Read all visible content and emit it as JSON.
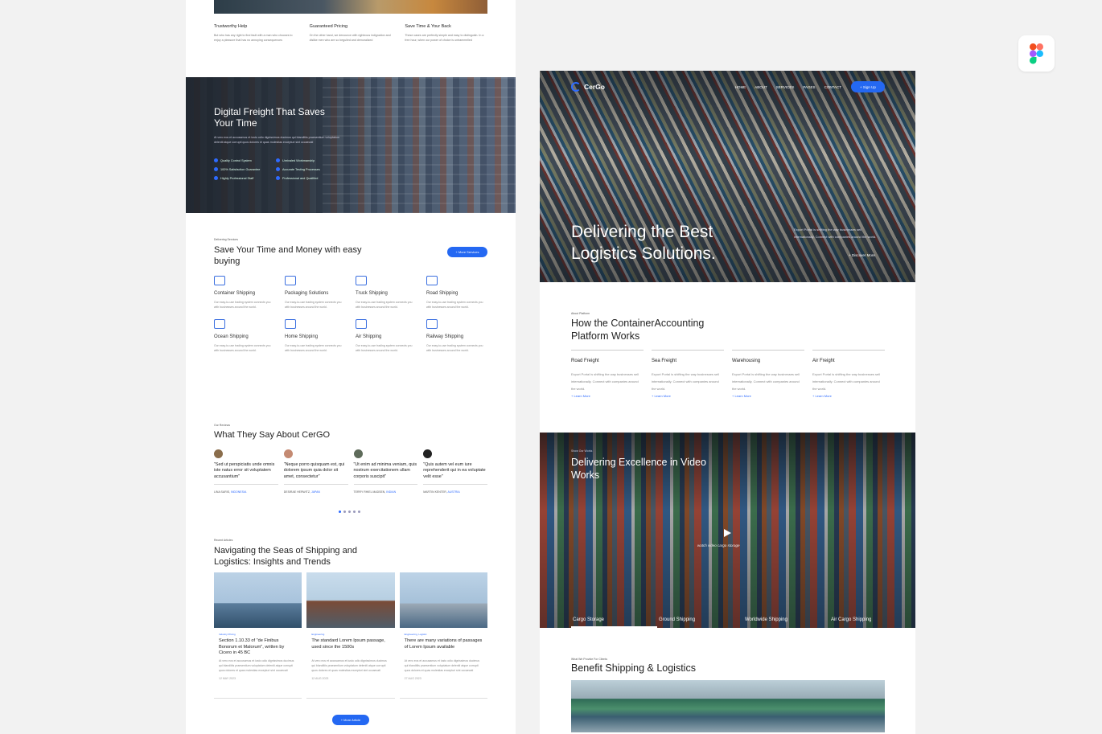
{
  "left": {
    "features": [
      {
        "title": "Trustworthy Help",
        "desc": "But who has any right to find fault with a man who chooses to enjoy a pleasure that has no annoying consequences"
      },
      {
        "title": "Guaranteed Pricing",
        "desc": "On the other hand, we denounce with righteous indignation and dislike men who are so beguiled and demoralized"
      },
      {
        "title": "Save Time & Your Back",
        "desc": "These cases are perfectly simple and easy to distinguish. In a free hour, when our power of choice is untrammelled"
      }
    ],
    "freight": {
      "title": "Digital Freight That Saves Your Time",
      "desc": "At vero eos et accusamus et iusto odio dignissimos ducimus qui blanditiis praesentium voluptatum deleniti atque corrupti quos dolores et quas molestias excepturi sint occaecati",
      "bullets": [
        "Quality Control System",
        "Unrivaled Workmanship",
        "100% Satisfaction Guarantee",
        "Accurate Testing Processes",
        "Highly Professional Staff",
        "Professional and Qualified"
      ]
    },
    "services": {
      "kicker": "Delivering Services",
      "title": "Save Your Time and Money with easy buying",
      "button": "+ More Services",
      "items": [
        {
          "icon": "container-icon",
          "title": "Container Shipping",
          "desc": "Our easy-to-use trading system connects you with businesses around the world."
        },
        {
          "icon": "box-icon",
          "title": "Packaging Solutions",
          "desc": "Our easy-to-use trading system connects you with businesses around the world."
        },
        {
          "icon": "truck-icon",
          "title": "Truck Shipping",
          "desc": "Our easy-to-use trading system connects you with businesses around the world."
        },
        {
          "icon": "road-icon",
          "title": "Road Shipping",
          "desc": "Our easy-to-use trading system connects you with businesses around the world."
        },
        {
          "icon": "ship-icon",
          "title": "Ocean Shipping",
          "desc": "Our easy-to-use trading system connects you with businesses around the world."
        },
        {
          "icon": "home-icon",
          "title": "Home Shipping",
          "desc": "Our easy-to-use trading system connects you with businesses around the world."
        },
        {
          "icon": "plane-icon",
          "title": "Air Shipping",
          "desc": "Our easy-to-use trading system connects you with businesses around the world."
        },
        {
          "icon": "train-icon",
          "title": "Railway Shipping",
          "desc": "Our easy-to-use trading system connects you with businesses around the world."
        }
      ]
    },
    "testimonials": {
      "kicker": "Our Reviews",
      "title": "What They Say About CerGO",
      "items": [
        {
          "quote": "\"Sed ut perspiciatis unde omnis iste natus error sit voluptatem accusantium\"",
          "name": "LINA SARIS,",
          "country": "INDONESIA",
          "color": "#8a6d4b"
        },
        {
          "quote": "\"Neque porro quisquam est, qui dolorem ipsum quia dolor sit amet, consectetur\"",
          "name": "DESIRAE HERWITZ,",
          "country": "JAPAN",
          "color": "#c48a72"
        },
        {
          "quote": "\"Ut enim ad minima veniam, quis nostrum exercitationem ullam corporis suscipit\"",
          "name": "TERRY RHIEL MADSEN,",
          "country": "INDIAN",
          "color": "#5e6b5a"
        },
        {
          "quote": "\"Quis autem vel eum iure reprehenderit qui in ea voluptate velit esse\"",
          "name": "MARTIN KENTER,",
          "country": "AUSTRIA",
          "color": "#222222"
        }
      ]
    },
    "blog": {
      "kicker": "Recent Articles",
      "title": "Navigating the Seas of Shipping and Logistics: Insights and Trends",
      "button": "+ More Article",
      "items": [
        {
          "cat": "Industry Pricing",
          "title": "Section 1.10.33 of \"de Finibus Bonorum et Malorum\", written by Cicero in 45 BC",
          "desc": "At vero eos et accusamus et iusto odio dignissimos ducimus qui blanditiis praesentium voluptatum deleniti atque corrupti quos dolores et quas molestias excepturi sint occaecati",
          "date": "12 MAY 2023"
        },
        {
          "cat": "Engineering",
          "title": "The standard Lorem Ipsum passage, used since the 1500s",
          "desc": "At vero eos et accusamus et iusto odio dignissimos ducimus qui blanditiis praesentium voluptatum deleniti atque corrupti quos dolores et quas molestias excepturi sint occaecati",
          "date": "12 AUG 2023"
        },
        {
          "cat": "Engineering, Logistic",
          "title": "There are many variations of passages of Lorem Ipsum available",
          "desc": "At vero eos et accusamus et iusto odio dignissimos ducimus qui blanditiis praesentium voluptatum deleniti atque corrupti quos dolores et quas molestias excepturi sint occaecati",
          "date": "27 AUG 2023"
        }
      ]
    }
  },
  "right": {
    "nav": {
      "brand": "CerGo",
      "items": [
        "HOME",
        "ABOUT",
        "SERVICES",
        "PAGES",
        "CONTACT"
      ],
      "signup": "+ Sign Up"
    },
    "hero": {
      "title": "Delivering the Best Logistics Solutions.",
      "side": "Export Portal is shifting the way businesses sell internationally. Connect with companies around the world.",
      "discover": "+ Discover More"
    },
    "platform": {
      "kicker": "About Platform",
      "title": "How the ContainerAccounting Platform Works",
      "cols": [
        {
          "title": "Road Freight",
          "desc": "Export Portal is shifting the way businesses sell internationally. Connect with companies around the world.",
          "link": "+ Learn More"
        },
        {
          "title": "Sea Freight",
          "desc": "Export Portal is shifting the way businesses sell internationally. Connect with companies around the world.",
          "link": "+ Learn More"
        },
        {
          "title": "Warehousing",
          "desc": "Export Portal is shifting the way businesses sell internationally. Connect with companies around the world.",
          "link": "+ Learn More"
        },
        {
          "title": "Air Freight",
          "desc": "Export Portal is shifting the way businesses sell internationally. Connect with companies around the world.",
          "link": "+ Learn More"
        }
      ]
    },
    "video": {
      "kicker": "Show Our Works",
      "title": "Delivering Excellence in Video Works",
      "caption": "watch video cargo storage",
      "tabs": [
        "Cargo Storage",
        "Ground Shipping",
        "Worldwide Shipping",
        "Air Cargo Shipping"
      ]
    },
    "benefit": {
      "kicker": "What We Provide For Clients",
      "title": "Benefit Shipping & Logistics"
    }
  },
  "colors": {
    "accent": "#2468f2",
    "page_bg": "#f2f2f2"
  }
}
